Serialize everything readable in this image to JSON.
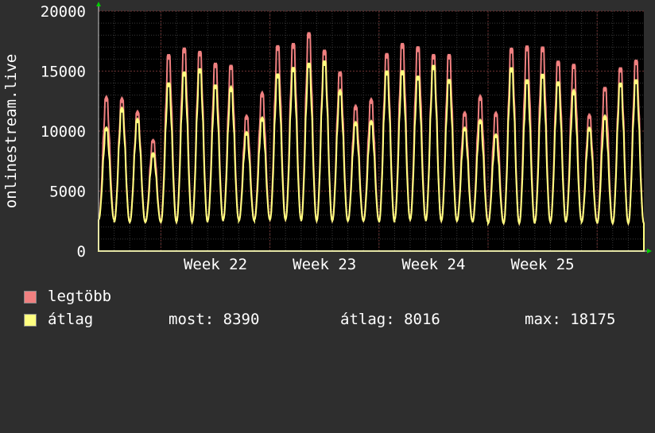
{
  "chart_data": {
    "type": "area",
    "ylabel": "onlinestream.live",
    "xlabel": "",
    "ylim": [
      0,
      20000
    ],
    "yticks": [
      0,
      5000,
      10000,
      15000,
      20000
    ],
    "xticks": [
      "Week 22",
      "Week 23",
      "Week 24",
      "Week 25"
    ],
    "grid": true,
    "days": 35,
    "daily_peak_max": [
      13800,
      13700,
      12500,
      9900,
      17800,
      18400,
      18100,
      17000,
      16800,
      12100,
      14200,
      18600,
      18800,
      19800,
      18200,
      16200,
      13000,
      13600,
      17900,
      18800,
      18500,
      17800,
      17800,
      12400,
      13900,
      12400,
      18400,
      18600,
      18500,
      17200,
      16900,
      12200,
      14800,
      16600,
      17300
    ],
    "daily_peak_avg": [
      11000,
      12800,
      11800,
      8700,
      15200,
      16200,
      16500,
      15000,
      14700,
      10600,
      11900,
      16000,
      16600,
      17000,
      17200,
      14400,
      11500,
      11600,
      16300,
      16300,
      15800,
      16800,
      15500,
      11000,
      11700,
      10400,
      16600,
      15500,
      16000,
      15300,
      14400,
      11000,
      12100,
      15200,
      15500
    ],
    "daily_min": [
      2600,
      2400,
      2400,
      2400,
      2400,
      2400,
      2400,
      2500,
      2600,
      2500,
      2600,
      2600,
      2600,
      2500,
      2500,
      2500,
      2500,
      2500,
      2400,
      2600,
      2600,
      2500,
      2500,
      2500,
      2400,
      2300,
      2300,
      2300,
      2400,
      2400,
      2500,
      2400,
      2300,
      2300,
      2300
    ],
    "series": [
      {
        "name": "legtöbb",
        "color": "#f08080"
      },
      {
        "name": "átlag",
        "color": "#ffff80"
      }
    ]
  },
  "legend": {
    "max_label": "legtöbb",
    "avg_label": "átlag",
    "current": "most: 8390",
    "average": "átlag: 8016",
    "maximum": "max: 18175"
  },
  "colors": {
    "background": "#2e2e2e",
    "plot_background": "#000000",
    "grid_major": "#6b3030",
    "grid_minor": "#3a3a3a",
    "axis": "#cccccc",
    "arrow": "#00cc00"
  }
}
